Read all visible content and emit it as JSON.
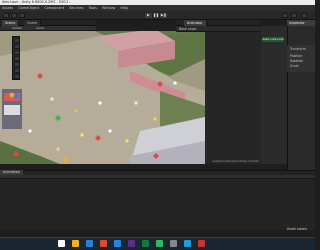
{
  "window": {
    "title": "ities Laun - Unity 6 6000.0.29f1 - DX11 -"
  },
  "menu": [
    "Assets",
    "GameObject",
    "Component",
    "Services",
    "Tools",
    "Window",
    "Help"
  ],
  "scene_tabs": [
    "Scene",
    "Game"
  ],
  "scene_toolbar": {
    "center_label": "Center",
    "local_label": "Local"
  },
  "play_controls": [
    "▶",
    "❚❚",
    "▶❚"
  ],
  "animator": {
    "tab": "Animator",
    "base_layer": "Base Layer",
    "layer_button": "Auto Live Link",
    "status_path": "Assets/Animations/Controller.controller"
  },
  "inspector": {
    "tab": "Inspector",
    "rows": [
      "Transform",
      "Position",
      "Rotation",
      "Scale"
    ]
  },
  "bottom": {
    "tab": "Animation",
    "asset_labels": "Asset Labels"
  },
  "taskbar": {
    "icon_colors": [
      "#ffffff",
      "#f2b31a",
      "#2a7ee0",
      "#e04a2a",
      "#1e88e5",
      "#5c2d91",
      "#0f7b3e",
      "#25c05c",
      "#888888",
      "#1f9bd7",
      "#cc3333"
    ]
  }
}
